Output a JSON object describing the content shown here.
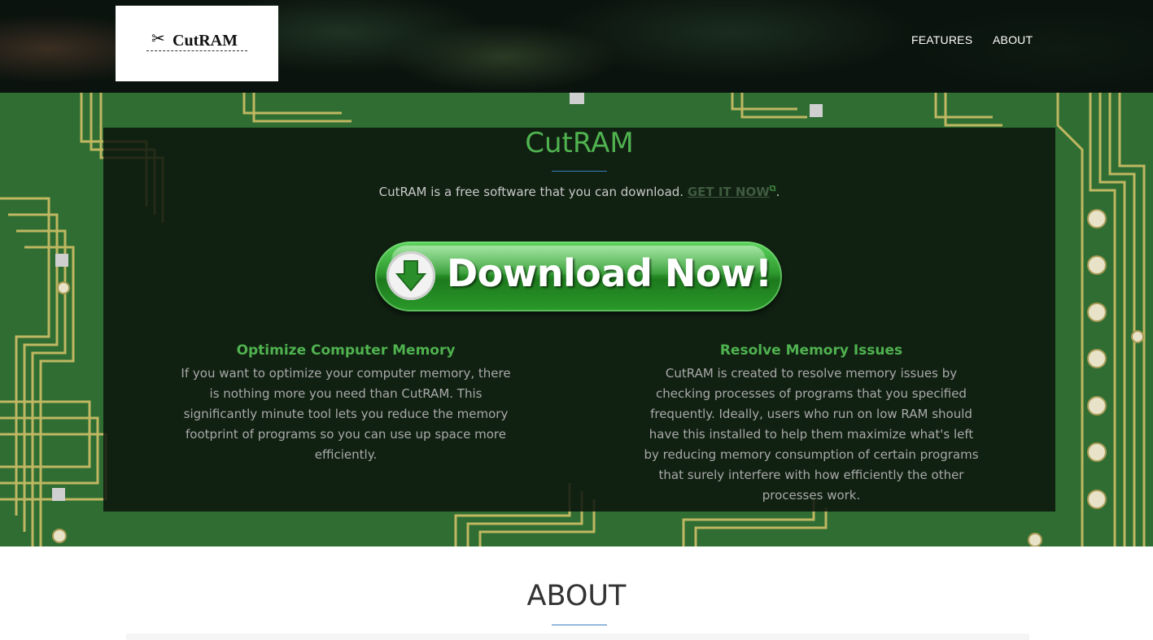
{
  "brand": {
    "logo_text": "CutRAM"
  },
  "nav": {
    "items": [
      {
        "label": "FEATURES"
      },
      {
        "label": "ABOUT"
      }
    ]
  },
  "hero": {
    "title": "CutRAM",
    "subtitle_prefix": "CutRAM is a free software that you can download.",
    "get_link_label": "GET IT NOW",
    "subtitle_suffix": ".",
    "download_button_label": "Download Now!"
  },
  "features": [
    {
      "title": "Optimize Computer Memory",
      "text": "If you want to optimize your computer memory, there is nothing more you need than CutRAM. This significantly minute tool lets you reduce the memory footprint of programs so you can use up space more efficiently."
    },
    {
      "title": "Resolve Memory Issues",
      "text": "CutRAM is created to resolve memory issues by checking processes of programs that you specified frequently. Ideally, users who run on low RAM should have this installed to help them maximize what's left by reducing memory consumption of certain programs that surely interfere with how efficiently the other processes work."
    }
  ],
  "about": {
    "title": "ABOUT"
  },
  "colors": {
    "accent_green": "#4fb24f",
    "divider_blue": "#3a7fc0",
    "pcb_green": "#2d6a32",
    "trace_gold": "#e6d27a"
  },
  "icons": {
    "logo": "scissors-icon",
    "external_link": "external-link-icon",
    "download": "download-arrow-icon"
  }
}
